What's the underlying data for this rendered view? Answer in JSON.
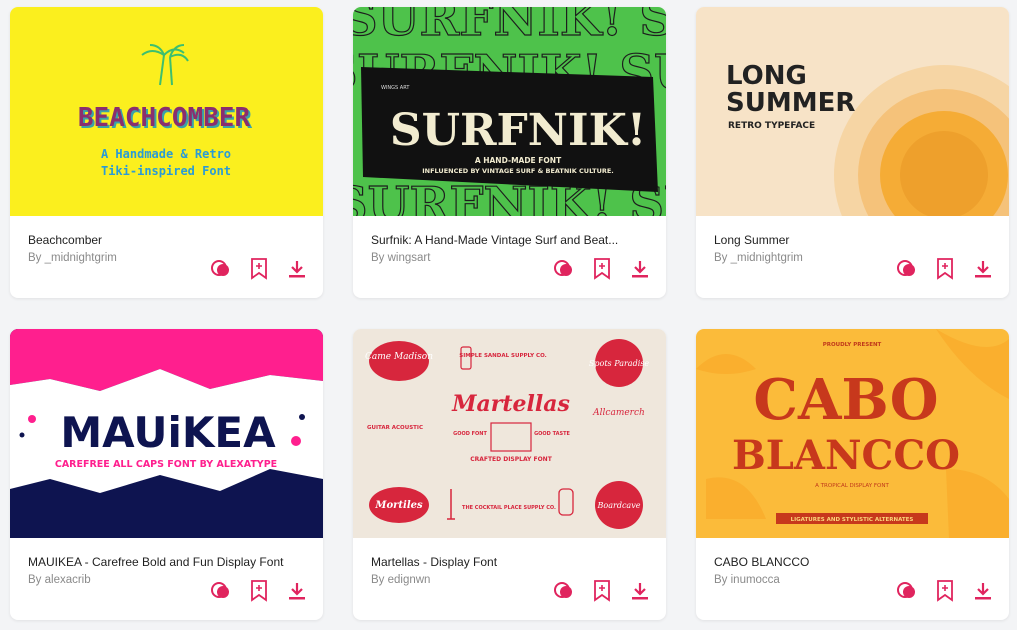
{
  "accent": "#e0245e",
  "cards": [
    {
      "title": "Beachcomber",
      "author": "By _midnightgrim",
      "thumb_lines": [
        "BEACHCOMBER",
        "A Handmade & Retro",
        "Tiki-inspired Font"
      ],
      "bg": "#fbef1e"
    },
    {
      "title": "Surfnik: A Hand-Made Vintage Surf and Beat...",
      "author": "By wingsart",
      "thumb_lines": [
        "SURFNIK!",
        "A HAND-MADE FONT",
        "INFLUENCED BY VINTAGE SURF & BEATNIK CULTURE.",
        "WINGS ART"
      ],
      "bg": "#4ec24b"
    },
    {
      "title": "Long Summer",
      "author": "By _midnightgrim",
      "thumb_lines": [
        "LONG",
        "SUMMER",
        "RETRO TYPEFACE"
      ],
      "bg": "#f7e3c7"
    },
    {
      "title": "MAUIKEA - Carefree Bold and Fun Display Font",
      "author": "By alexacrib",
      "thumb_lines": [
        "MAUiKEA",
        "CAREFREE ALL CAPS FONT BY ALEXATYPE"
      ],
      "bg": "#ffffff"
    },
    {
      "title": "Martellas - Display Font",
      "author": "By edignwn",
      "thumb_lines": [
        "Martellas",
        "CRAFTED DISPLAY FONT",
        "Came Madison",
        "Spots Paradise",
        "Mortiles",
        "Boardcave",
        "SIMPLE SANDAL SUPPLY CO.",
        "Allcamerch",
        "GUITAR ACOUSTIC",
        "GOOD FONT",
        "GOOD TASTE",
        "THE COCKTAIL PLACE SUPPLY CO."
      ],
      "bg": "#efe7dc"
    },
    {
      "title": "CABO BLANCCO",
      "author": "By inumocca",
      "thumb_lines": [
        "PROUDLY PRESENT",
        "CABO",
        "BLANCCO",
        "A TROPICAL DISPLAY FONT",
        "LIGATURES AND STYLISTIC ALTERNATES"
      ],
      "bg": "#fbbb3a"
    }
  ],
  "icons": [
    "colors-icon",
    "bookmark-add-icon",
    "download-icon"
  ]
}
